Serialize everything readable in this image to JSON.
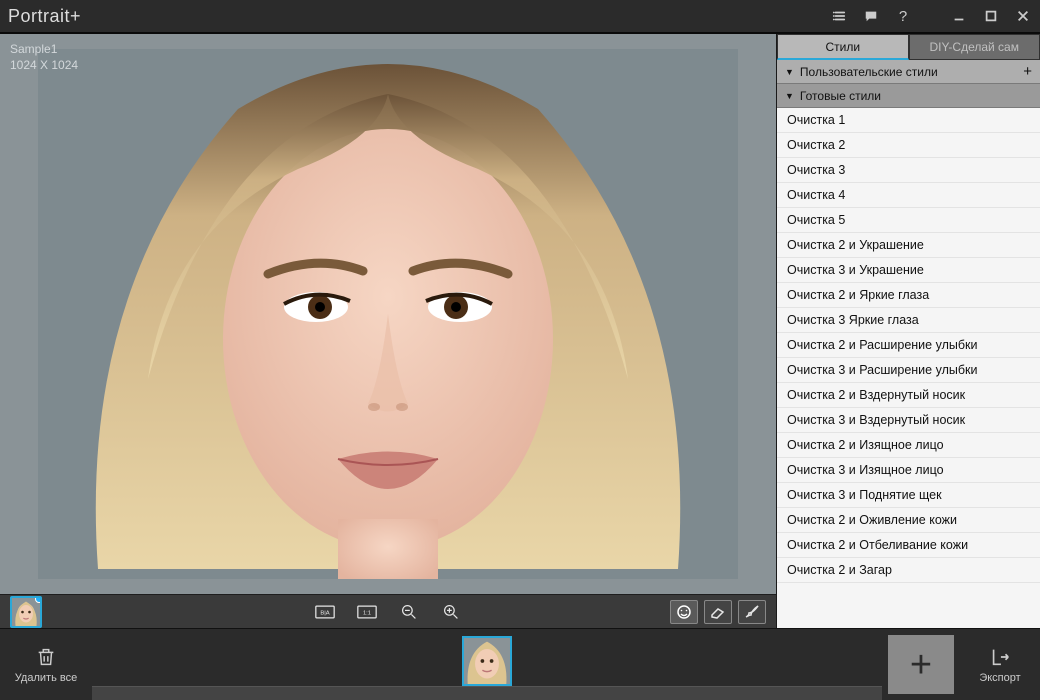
{
  "app": {
    "title": "Portrait+"
  },
  "imageInfo": {
    "name": "Sample1",
    "dims": "1024 X 1024"
  },
  "tabs": {
    "styles": "Стили",
    "diy": "DIY-Сделай сам"
  },
  "accordion": {
    "userStyles": "Пользовательские стили",
    "presetStyles": "Готовые стили"
  },
  "styles": [
    "Очистка 1",
    "Очистка 2",
    "Очистка 3",
    "Очистка 4",
    "Очистка 5",
    "Очистка 2 и Украшение",
    "Очистка 3 и Украшение",
    "Очистка 2 и Яркие глаза",
    "Очистка 3 Яркие глаза",
    "Очистка 2 и Расширение улыбки",
    "Очистка 3 и Расширение улыбки",
    "Очистка 2 и Вздернутый носик",
    "Очистка 3 и Вздернутый носик",
    "Очистка 2 и Изящное лицо",
    "Очистка 3 и Изящное лицо",
    "Очистка 3 и Поднятие щек",
    "Очистка 2 и Оживление кожи",
    "Очистка 2 и Отбеливание кожи",
    "Очистка 2 и Загар"
  ],
  "footer": {
    "deleteAll": "Удалить все",
    "export": "Экспорт"
  }
}
